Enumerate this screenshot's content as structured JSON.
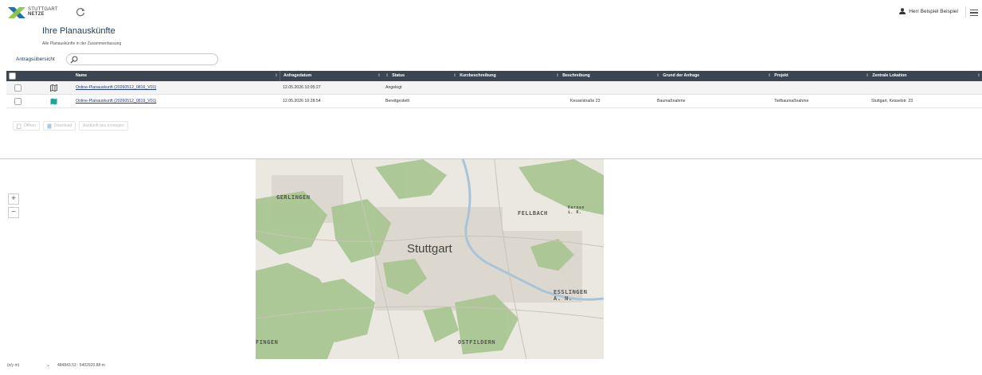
{
  "header": {
    "logo_line1": "STUTTGART",
    "logo_line2": "NETZE",
    "user_name": "Herr Beispiel Beispiel"
  },
  "page": {
    "title": "Ihre Planauskünfte",
    "subtitle": "Alle Planauskünfte in der Zusammenfassung",
    "overview_label": "Antragsübersicht",
    "search_placeholder": ""
  },
  "table": {
    "columns": [
      "Name",
      "Anfragedatum",
      "Status",
      "Kurzbeschreibung",
      "Beschreibung",
      "Grund der Anfrage",
      "Projekt",
      "Zentrale Lokation"
    ],
    "rows": [
      {
        "name": "Online-Planauskunft (20260512_0816_V01)",
        "date": "12.05.2026 10:05:27",
        "status": "Angelegt",
        "short": "",
        "description": "",
        "reason": "",
        "project": "",
        "location": "",
        "icon": "map-outline-icon"
      },
      {
        "name": "Online-Planauskunft (20260512_0819_V01)",
        "date": "12.05.2026 10:28:54",
        "status": "Bereitgestellt",
        "short": "",
        "description": "Kesselstraße 23",
        "reason": "Baumaßnahme",
        "project": "Tiefbaumaßnahme",
        "location": "Stuttgart, Kesselstr. 23",
        "icon": "map-filled-icon"
      }
    ]
  },
  "actions": {
    "open": "Öffnen",
    "download": "Download",
    "recreate": "Auskunft neu erzeugen"
  },
  "map": {
    "labels": {
      "gerlingen": "GERLINGEN",
      "fellbach": "FELLBACH",
      "kernen": "Kernen\ni. R.",
      "stuttgart": "Stuttgart",
      "esslingen": "ESSLINGEN\nA. N.",
      "fingen": "FINGEN",
      "ostfildern": "OSTFILDERN"
    },
    "zoom_in": "+",
    "zoom_out": "−"
  },
  "footer": {
    "crs": "(x/y m)",
    "coordinates": "484843.53 : 5402920.88 m"
  },
  "colors": {
    "header_dark": "#3b4650",
    "accent_blue": "#1f3a5a",
    "map_green": "#a7c58f",
    "logo_green": "#8cc63f",
    "logo_blue": "#1f6fb5"
  }
}
